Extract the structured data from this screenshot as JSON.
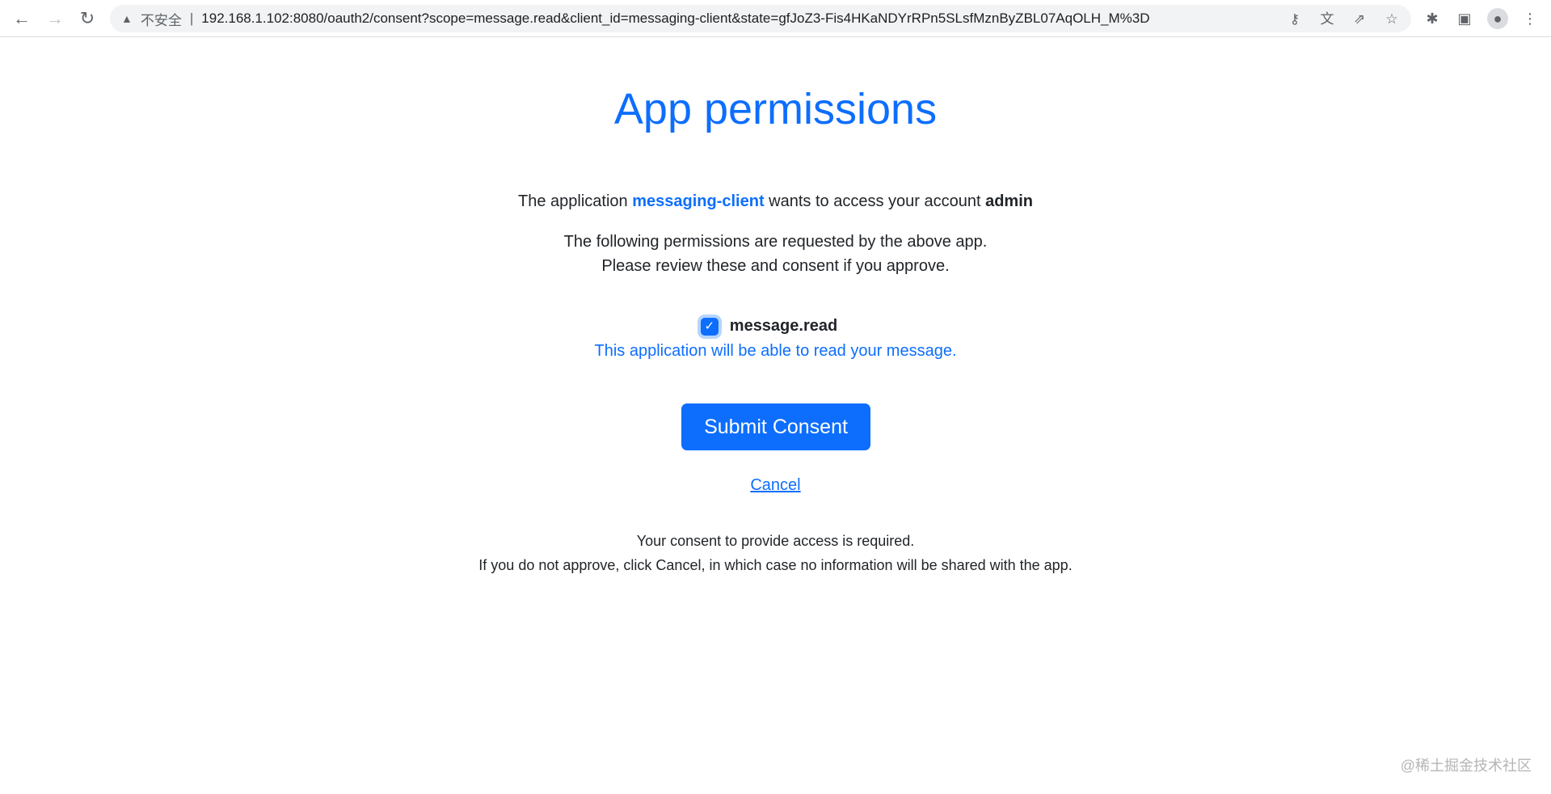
{
  "browser": {
    "insecure_label": "不安全",
    "url": "192.168.1.102:8080/oauth2/consent?scope=message.read&client_id=messaging-client&state=gfJoZ3-Fis4HKaNDYrRPn5SLsfMznByZBL07AqOLH_M%3D"
  },
  "page": {
    "title": "App permissions",
    "intro_prefix": "The application ",
    "client_id": "messaging-client",
    "intro_middle": " wants to access your account ",
    "account": "admin",
    "request_line1": "The following permissions are requested by the above app.",
    "request_line2": "Please review these and consent if you approve.",
    "scope": {
      "name": "message.read",
      "checked": true,
      "description": "This application will be able to read your message."
    },
    "submit_label": "Submit Consent",
    "cancel_label": "Cancel",
    "footer_line1": "Your consent to provide access is required.",
    "footer_line2": "If you do not approve, click Cancel, in which case no information will be shared with the app."
  },
  "watermark": "@稀土掘金技术社区",
  "colors": {
    "primary": "#0d6efd"
  }
}
